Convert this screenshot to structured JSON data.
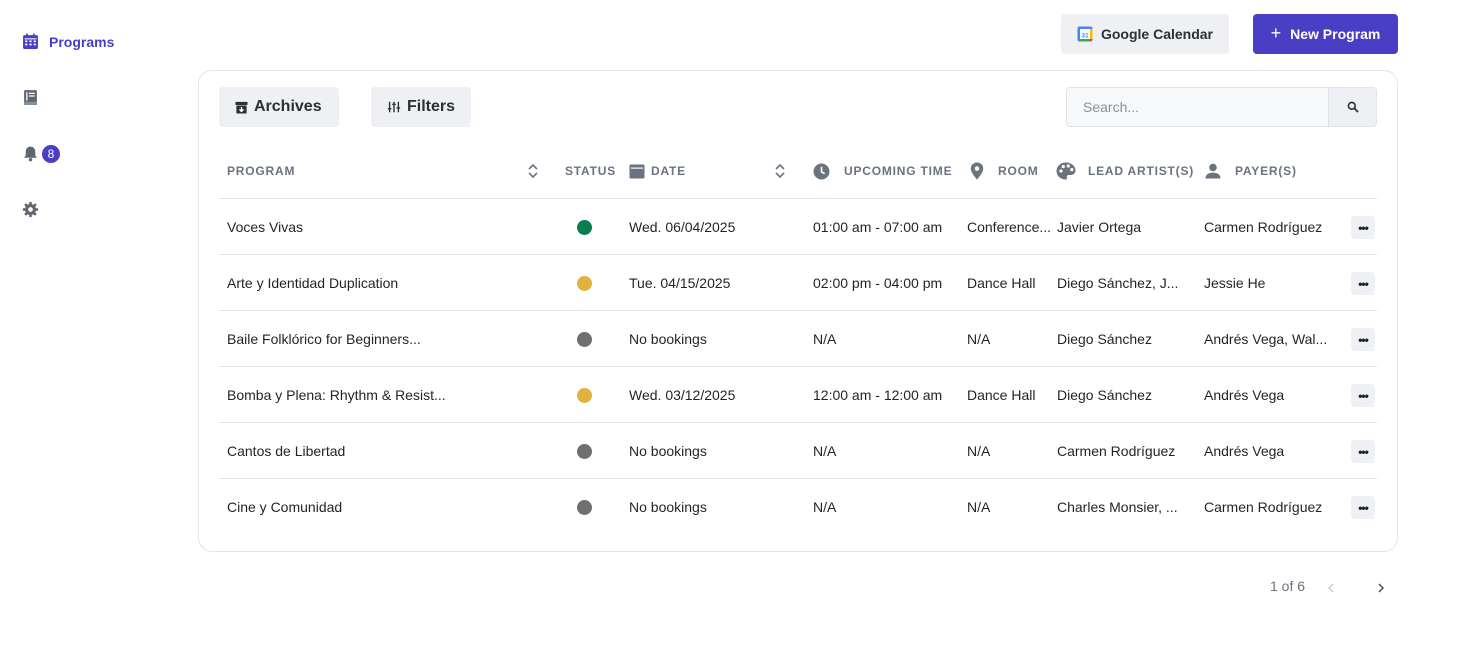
{
  "sidebar": {
    "programs_label": "Programs",
    "notification_count": "8",
    "items": [
      "calendar-icon",
      "book-icon",
      "bell-icon",
      "gear-icon"
    ]
  },
  "header": {
    "gcal_label": "Google Calendar",
    "new_program_label": "New Program"
  },
  "toolbar": {
    "archives_label": "Archives",
    "filters_label": "Filters",
    "search_placeholder": "Search..."
  },
  "table": {
    "headers": {
      "program": "PROGRAM",
      "status": "STATUS",
      "date": "DATE",
      "upcoming_time": "UPCOMING TIME",
      "room": "ROOM",
      "lead_artists": "LEAD ARTIST(S)",
      "payers": "PAYER(S)"
    },
    "rows": [
      {
        "program": "Voces Vivas",
        "status": "green",
        "date": "Wed. 06/04/2025",
        "time": "01:00 am - 07:00 am",
        "room": "Conference...",
        "lead": "Javier Ortega",
        "payer": "Carmen Rodríguez"
      },
      {
        "program": "Arte y Identidad Duplication",
        "status": "yellow",
        "date": "Tue. 04/15/2025",
        "time": "02:00 pm - 04:00 pm",
        "room": "Dance Hall",
        "lead": "Diego Sánchez, J...",
        "payer": "Jessie He"
      },
      {
        "program": "Baile Folklórico for Beginners...",
        "status": "gray",
        "date": "No bookings",
        "time": "N/A",
        "room": "N/A",
        "lead": "Diego Sánchez",
        "payer": "Andrés Vega, Wal..."
      },
      {
        "program": "Bomba y Plena: Rhythm & Resist...",
        "status": "yellow",
        "date": "Wed. 03/12/2025",
        "time": "12:00 am - 12:00 am",
        "room": "Dance Hall",
        "lead": "Diego Sánchez",
        "payer": "Andrés Vega"
      },
      {
        "program": "Cantos de Libertad",
        "status": "gray",
        "date": "No bookings",
        "time": "N/A",
        "room": "N/A",
        "lead": "Carmen Rodríguez",
        "payer": "Andrés Vega"
      },
      {
        "program": "Cine y Comunidad",
        "status": "gray",
        "date": "No bookings",
        "time": "N/A",
        "room": "N/A",
        "lead": "Charles Monsier, ...",
        "payer": "Carmen Rodríguez"
      }
    ]
  },
  "pagination": {
    "label": "1 of 6"
  },
  "colors": {
    "accent": "#4a3fc4",
    "status_green": "#0a7d4f",
    "status_yellow": "#e0b43a",
    "status_gray": "#707070"
  }
}
